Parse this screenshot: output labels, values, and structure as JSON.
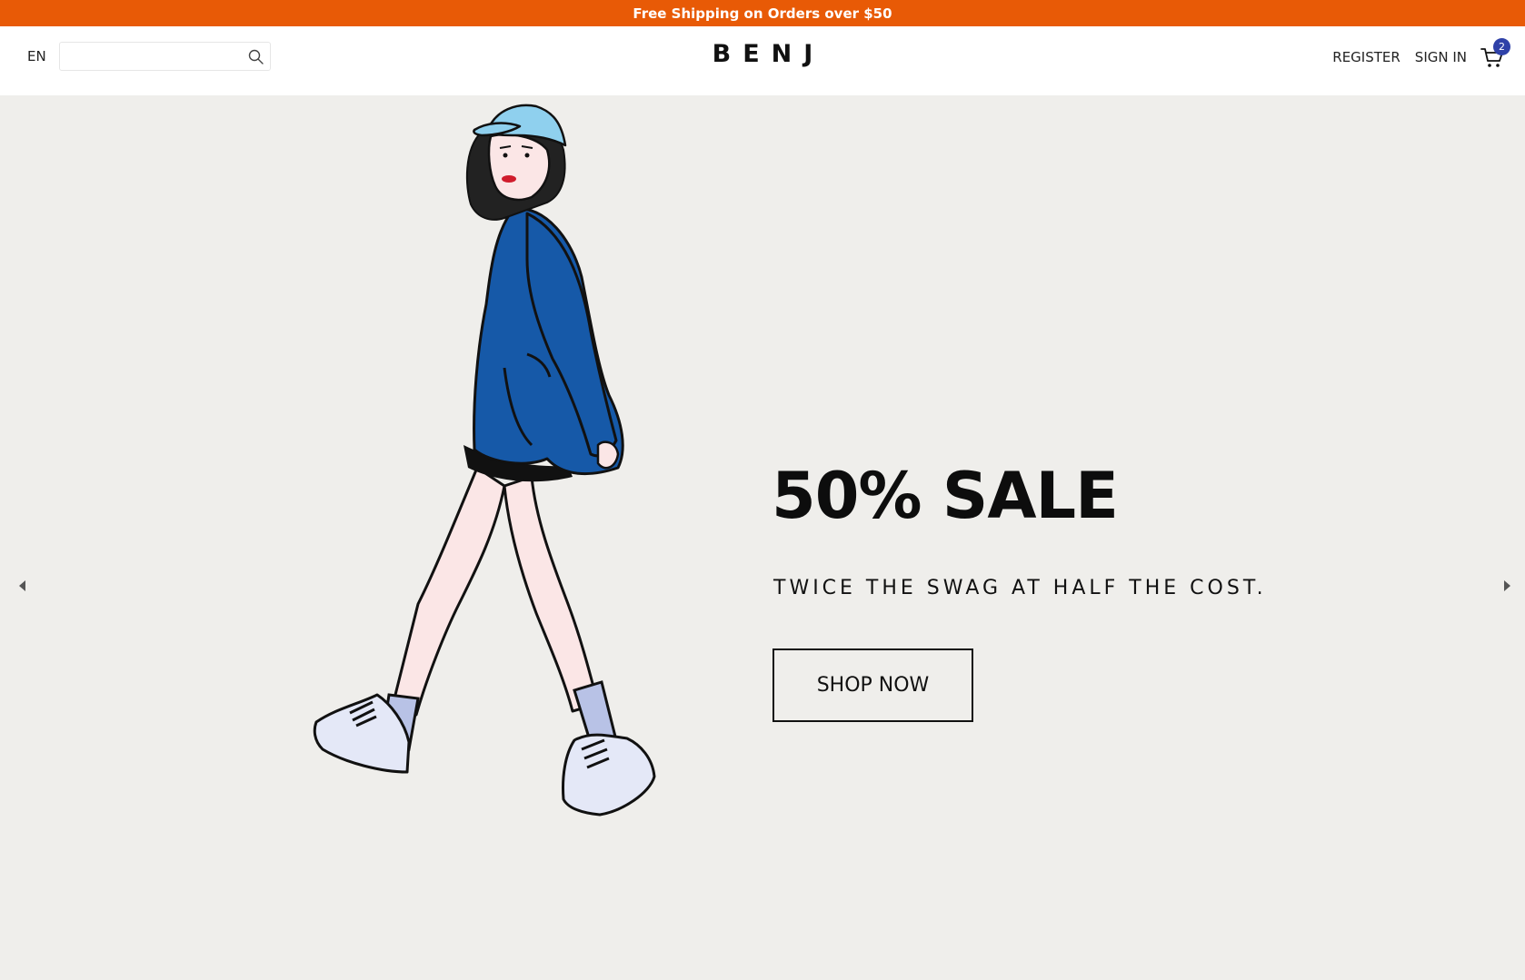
{
  "announcement": {
    "text": "Free Shipping on Orders over $50"
  },
  "header": {
    "language": "EN",
    "search": {
      "value": "",
      "placeholder": ""
    },
    "logo": "BENJ",
    "register_label": "REGISTER",
    "signin_label": "SIGN IN",
    "cart_count": "2"
  },
  "hero": {
    "headline": "50% SALE",
    "tagline": "TWICE THE SWAG AT HALF THE COST.",
    "cta_label": "SHOP NOW"
  },
  "colors": {
    "announcement_bg": "#e85a06",
    "hero_bg": "#efeeeb",
    "cart_badge": "#2f41a8",
    "sweater": "#1659a8",
    "cap": "#8fd0ee"
  },
  "icons": [
    "search-icon",
    "cart-icon",
    "chevron-left-icon",
    "chevron-right-icon"
  ]
}
